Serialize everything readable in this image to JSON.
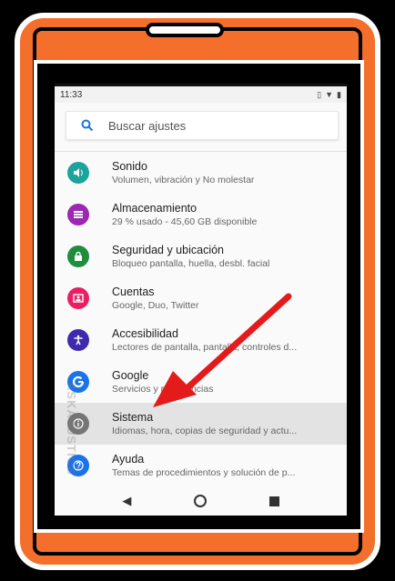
{
  "status_bar": {
    "time": "11:33",
    "icons": [
      "vibrate-icon",
      "wifi-icon",
      "battery-icon"
    ]
  },
  "search": {
    "placeholder": "Buscar ajustes"
  },
  "settings": [
    {
      "title": "Sonido",
      "subtitle": "Volumen, vibración y No molestar",
      "icon": "volume-icon",
      "color": "#1BA39C"
    },
    {
      "title": "Almacenamiento",
      "subtitle": "29 % usado - 45,60 GB disponible",
      "icon": "storage-icon",
      "color": "#9C27B0"
    },
    {
      "title": "Seguridad y ubicación",
      "subtitle": "Bloqueo pantalla, huella, desbl. facial",
      "icon": "lock-icon",
      "color": "#1E8E3E"
    },
    {
      "title": "Cuentas",
      "subtitle": "Google, Duo, Twitter",
      "icon": "account-icon",
      "color": "#E91E63"
    },
    {
      "title": "Accesibilidad",
      "subtitle": "Lectores de pantalla, pantalla, controles d...",
      "icon": "accessibility-icon",
      "color": "#3F2AAE"
    },
    {
      "title": "Google",
      "subtitle": "Servicios y preferencias",
      "icon": "google-icon",
      "color": "#1A73E8"
    },
    {
      "title": "Sistema",
      "subtitle": "Idiomas, hora, copias de seguridad y actu...",
      "icon": "info-icon",
      "color": "#757575"
    },
    {
      "title": "Ayuda",
      "subtitle": "Temas de procedimientos y solución de p...",
      "icon": "help-icon",
      "color": "#1A73E8"
    }
  ],
  "selected_index": 6,
  "accent_color": "#F36F2B",
  "arrow_color": "#E31B1B",
  "watermark": "ASKAJUSTICS"
}
